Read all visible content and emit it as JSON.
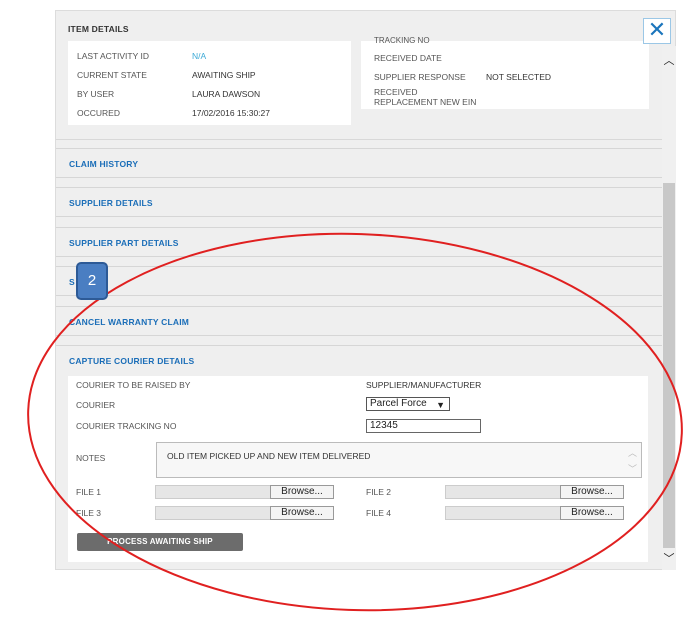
{
  "item_details": {
    "heading": "ITEM DETAILS",
    "left": [
      {
        "label": "LAST ACTIVITY ID",
        "value": "N/A"
      },
      {
        "label": "CURRENT STATE",
        "value": "AWAITING SHIP"
      },
      {
        "label": "BY USER",
        "value": "LAURA DAWSON"
      },
      {
        "label": "OCCURED",
        "value": "17/02/2016 15:30:27"
      }
    ],
    "right": {
      "tracking_no_label": "TRACKING NO",
      "received_date_label": "RECEIVED DATE",
      "supplier_response_label": "SUPPLIER RESPONSE",
      "supplier_response_value": "NOT SELECTED",
      "received_line1": "RECEIVED",
      "received_line2": "REPLACEMENT NEW EIN"
    }
  },
  "sections": [
    {
      "title": "CLAIM HISTORY"
    },
    {
      "title": "SUPPLIER DETAILS"
    },
    {
      "title": "SUPPLIER PART DETAILS"
    },
    {
      "title": "S"
    },
    {
      "title": "CANCEL WARRANTY CLAIM"
    }
  ],
  "capture": {
    "title": "CAPTURE COURIER DETAILS",
    "raised_by_label": "COURIER TO BE RAISED BY",
    "raised_by_value": "SUPPLIER/MANUFACTURER",
    "courier_label": "COURIER",
    "courier_value": "Parcel Force",
    "tracking_label": "COURIER TRACKING NO",
    "tracking_value": "12345",
    "notes_label": "NOTES",
    "notes_value": "OLD ITEM PICKED UP AND NEW ITEM DELIVERED",
    "file1_label": "FILE 1",
    "file2_label": "FILE 2",
    "file3_label": "FILE 3",
    "file4_label": "FILE 4",
    "browse_label": "Browse...",
    "process_label": "PROCESS AWAITING SHIP"
  },
  "close_glyph": "✕",
  "callout_number": "2",
  "icons": {
    "close": "close-icon",
    "scroll_up": "chevron-up-icon",
    "scroll_down": "chevron-down-icon",
    "select": "chevron-down-icon"
  },
  "colors": {
    "section_title": "#1b6eb8",
    "link": "#3ba9d6",
    "button": "#6c6c6c",
    "annotation": "#e02020",
    "callout": "#4a7ec2"
  }
}
